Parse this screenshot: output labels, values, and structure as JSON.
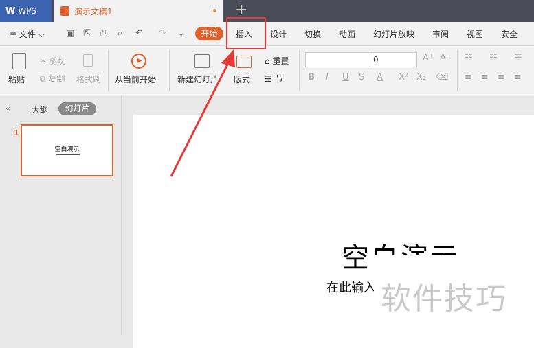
{
  "titlebar": {
    "app_tab": "WPS",
    "doc_tab": "演示文稿1",
    "new_tab": "+"
  },
  "menu": {
    "file": "文件",
    "start": "开始",
    "items": [
      "插入",
      "设计",
      "切换",
      "动画",
      "幻灯片放映",
      "审阅",
      "视图",
      "安全"
    ]
  },
  "ribbon": {
    "paste": "粘贴",
    "cut": "剪切",
    "copy": "复制",
    "format_painter": "格式刷",
    "play_from_current": "从当前开始",
    "new_slide": "新建幻灯片",
    "layout": "版式",
    "reset": "重置",
    "section": "节",
    "font_size": "0"
  },
  "left_panel": {
    "tab_outline": "大纲",
    "tab_slides": "幻灯片",
    "slide_number": "1",
    "thumb_title": "空白演示"
  },
  "slide": {
    "title": "空白演示",
    "subtitle": "在此输入"
  },
  "watermark": "软件技巧",
  "colors": {
    "accent": "#e0612c",
    "highlight": "#e53935",
    "wps_tab": "#3c63b0"
  }
}
